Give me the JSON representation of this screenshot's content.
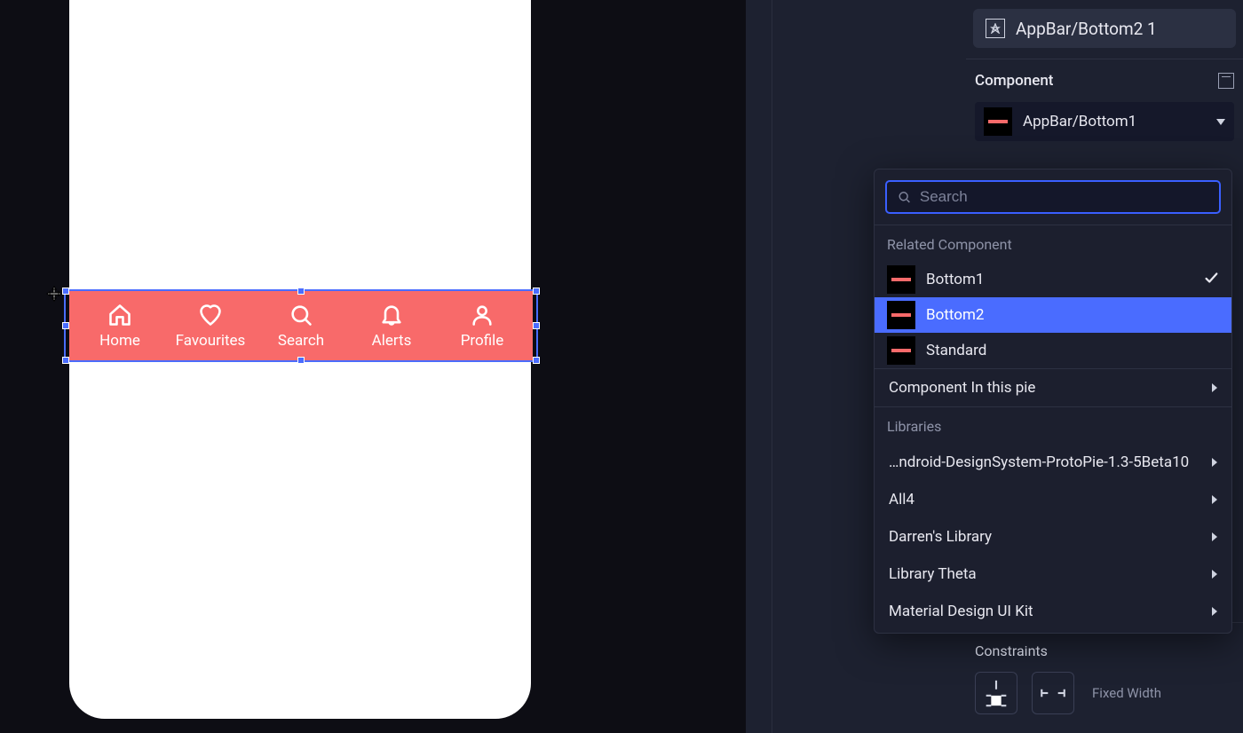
{
  "canvas": {
    "nav_items": [
      {
        "label": "Home"
      },
      {
        "label": "Favourites"
      },
      {
        "label": "Search"
      },
      {
        "label": "Alerts"
      },
      {
        "label": "Profile"
      }
    ]
  },
  "panel": {
    "chip_label": "AppBar/Bottom2 1",
    "component_section_title": "Component",
    "component_value": "AppBar/Bottom1",
    "constraints_label": "Constraints",
    "fixed_width_label": "Fixed Width"
  },
  "dropdown": {
    "search_placeholder": "Search",
    "related_label": "Related Component",
    "related_items": [
      {
        "label": "Bottom1",
        "checked": true
      },
      {
        "label": "Bottom2",
        "selected": true
      },
      {
        "label": "Standard"
      }
    ],
    "component_in_pie": "Component In this pie",
    "libraries_label": "Libraries",
    "libraries": [
      "…ndroid-DesignSystem-ProtoPie-1.3-5Beta10",
      "All4",
      "Darren's Library",
      "Library Theta",
      "Material Design UI Kit"
    ]
  }
}
